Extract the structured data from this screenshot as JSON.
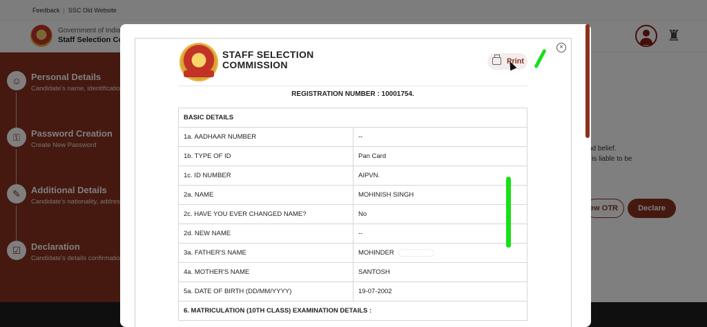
{
  "topbar": {
    "feedback": "Feedback",
    "separator": "|",
    "old_site": "SSC Old Website"
  },
  "header": {
    "gov_label": "Government of India",
    "org_label": "Staff Selection Commission"
  },
  "sidebar": {
    "steps": [
      {
        "title": "Personal Details",
        "desc": "Candidate's name, identification, contact",
        "icon": "user-icon"
      },
      {
        "title": "Password Creation",
        "desc": "Create New Password",
        "icon": "key-icon"
      },
      {
        "title": "Additional Details",
        "desc": "Candidate's nationality, address, education",
        "icon": "document-icon"
      },
      {
        "title": "Declaration",
        "desc": "Candidate's details confirmation",
        "icon": "checklist-icon"
      }
    ]
  },
  "background": {
    "text1": "nd belief.",
    "text2": "nt is liable to be",
    "view_btn": "iew OTR",
    "declare_btn": "Declare"
  },
  "modal": {
    "org_line1": "STAFF SELECTION",
    "org_line2": "COMMISSION",
    "print_label": "Print",
    "close_symbol": "×",
    "registration": "REGISTRATION NUMBER : 10001754.",
    "section_basic": "BASIC DETAILS",
    "rows": [
      {
        "label": "1a. AADHAAR NUMBER",
        "value": "--"
      },
      {
        "label": "1b. TYPE OF ID",
        "value": "Pan Card"
      },
      {
        "label": "1c. ID NUMBER",
        "value": "AIPVN."
      },
      {
        "label": "2a. NAME",
        "value": "MOHINISH SINGH"
      },
      {
        "label": "2c. HAVE YOU EVER CHANGED NAME?",
        "value": "No"
      },
      {
        "label": "2d. NEW NAME",
        "value": "--"
      },
      {
        "label": "3a. FATHER'S NAME",
        "value": "MOHINDER"
      },
      {
        "label": "4a. MOTHER'S NAME",
        "value": "SANTOSH"
      },
      {
        "label": "5a. DATE OF BIRTH (DD/MM/YYYY)",
        "value": "19-07-2002"
      }
    ],
    "section_matric": "6. MATRICULATION (10TH CLASS) EXAMINATION DETAILS :"
  },
  "colors": {
    "brand": "#8b3320",
    "annotation": "#18e018"
  }
}
